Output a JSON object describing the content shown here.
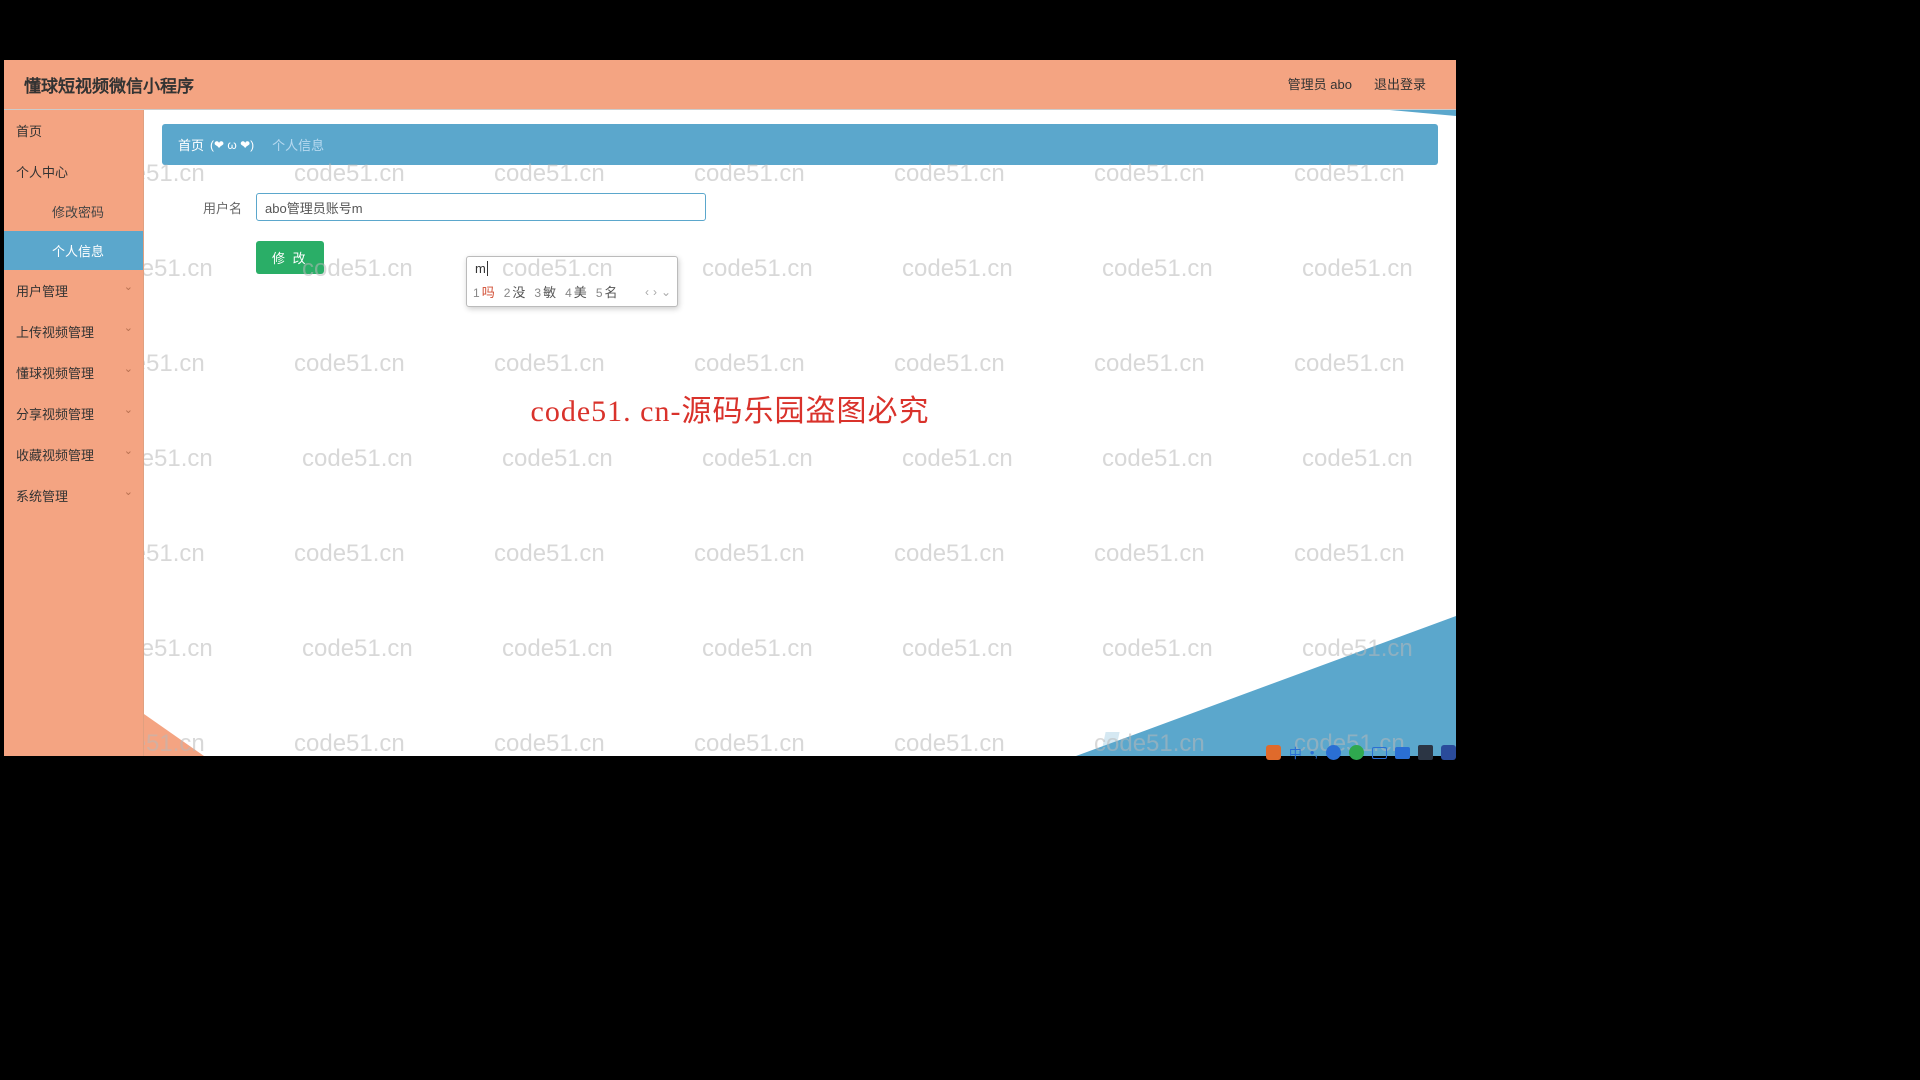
{
  "header": {
    "title": "懂球短视频微信小程序",
    "admin_label": "管理员 abo",
    "logout_label": "退出登录"
  },
  "sidebar": {
    "items": [
      {
        "label": "首页",
        "expandable": false
      },
      {
        "label": "个人中心",
        "expandable": false
      },
      {
        "label": "用户管理",
        "expandable": true
      },
      {
        "label": "上传视频管理",
        "expandable": true
      },
      {
        "label": "懂球视频管理",
        "expandable": true
      },
      {
        "label": "分享视频管理",
        "expandable": true
      },
      {
        "label": "收藏视频管理",
        "expandable": true
      },
      {
        "label": "系统管理",
        "expandable": true
      }
    ],
    "submenu": {
      "change_password": "修改密码",
      "personal_info": "个人信息"
    }
  },
  "breadcrumb": {
    "home": "首页",
    "emoji": "(❤ ω ❤)",
    "current": "个人信息"
  },
  "form": {
    "username_label": "用户名",
    "username_value": "abo管理员账号m",
    "submit_label": "修 改"
  },
  "ime": {
    "typed": "m",
    "candidates": [
      {
        "num": "1",
        "char": "吗",
        "selected": true
      },
      {
        "num": "2",
        "char": "没",
        "selected": false
      },
      {
        "num": "3",
        "char": "敏",
        "selected": false
      },
      {
        "num": "4",
        "char": "美",
        "selected": false
      },
      {
        "num": "5",
        "char": "名",
        "selected": false
      }
    ],
    "nav_prev": "‹",
    "nav_next": "›",
    "nav_more": "⌄"
  },
  "watermark": {
    "text": "code51.cn",
    "center": "code51. cn-源码乐园盗图必究"
  }
}
